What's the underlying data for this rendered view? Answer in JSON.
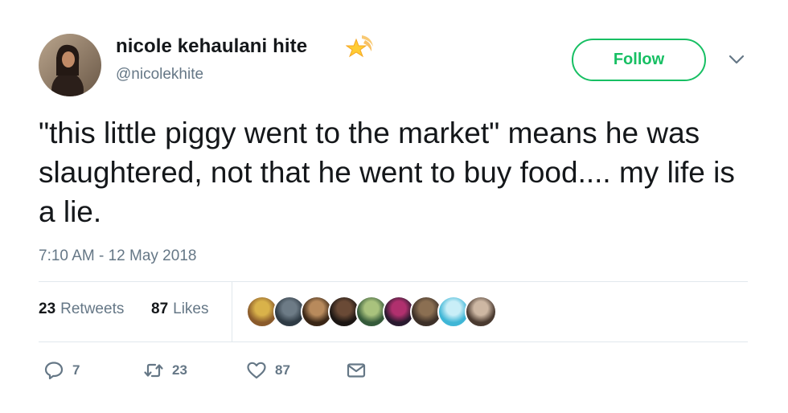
{
  "user": {
    "display_name": "nicole kehaulani hite",
    "handle": "@nicolekhite",
    "badge_icon": "shooting-star-emoji"
  },
  "follow_button": {
    "label": "Follow"
  },
  "tweet": {
    "text": "\"this little piggy went to the market\" means he was slaughtered, not that he went to buy food.... my life is a lie.",
    "timestamp": "7:10 AM - 12 May 2018"
  },
  "stats": {
    "retweets_count": "23",
    "retweets_label": "Retweets",
    "likes_count": "87",
    "likes_label": "Likes"
  },
  "liker_avatars": [
    {
      "name": "liker-avatar-1",
      "colors": [
        "#8a5a2b",
        "#d9b24a"
      ]
    },
    {
      "name": "liker-avatar-2",
      "colors": [
        "#2f3b45",
        "#6d7b86"
      ]
    },
    {
      "name": "liker-avatar-3",
      "colors": [
        "#3a2616",
        "#b88a5c"
      ]
    },
    {
      "name": "liker-avatar-4",
      "colors": [
        "#1c1613",
        "#6a4a36"
      ]
    },
    {
      "name": "liker-avatar-5",
      "colors": [
        "#355a3a",
        "#a9c27d"
      ]
    },
    {
      "name": "liker-avatar-6",
      "colors": [
        "#2a1a2f",
        "#b0306e"
      ]
    },
    {
      "name": "liker-avatar-7",
      "colors": [
        "#3d3028",
        "#8b6f52"
      ]
    },
    {
      "name": "liker-avatar-8",
      "colors": [
        "#3fb6d6",
        "#c9eef7"
      ]
    },
    {
      "name": "liker-avatar-9",
      "colors": [
        "#4a3a30",
        "#cdb7a3"
      ]
    }
  ],
  "actions": {
    "reply_count": "7",
    "retweet_count": "23",
    "like_count": "87"
  },
  "colors": {
    "follow_green": "#17bf63",
    "secondary_text": "#657786",
    "divider": "#e1e8ed",
    "primary_text": "#14171a"
  }
}
